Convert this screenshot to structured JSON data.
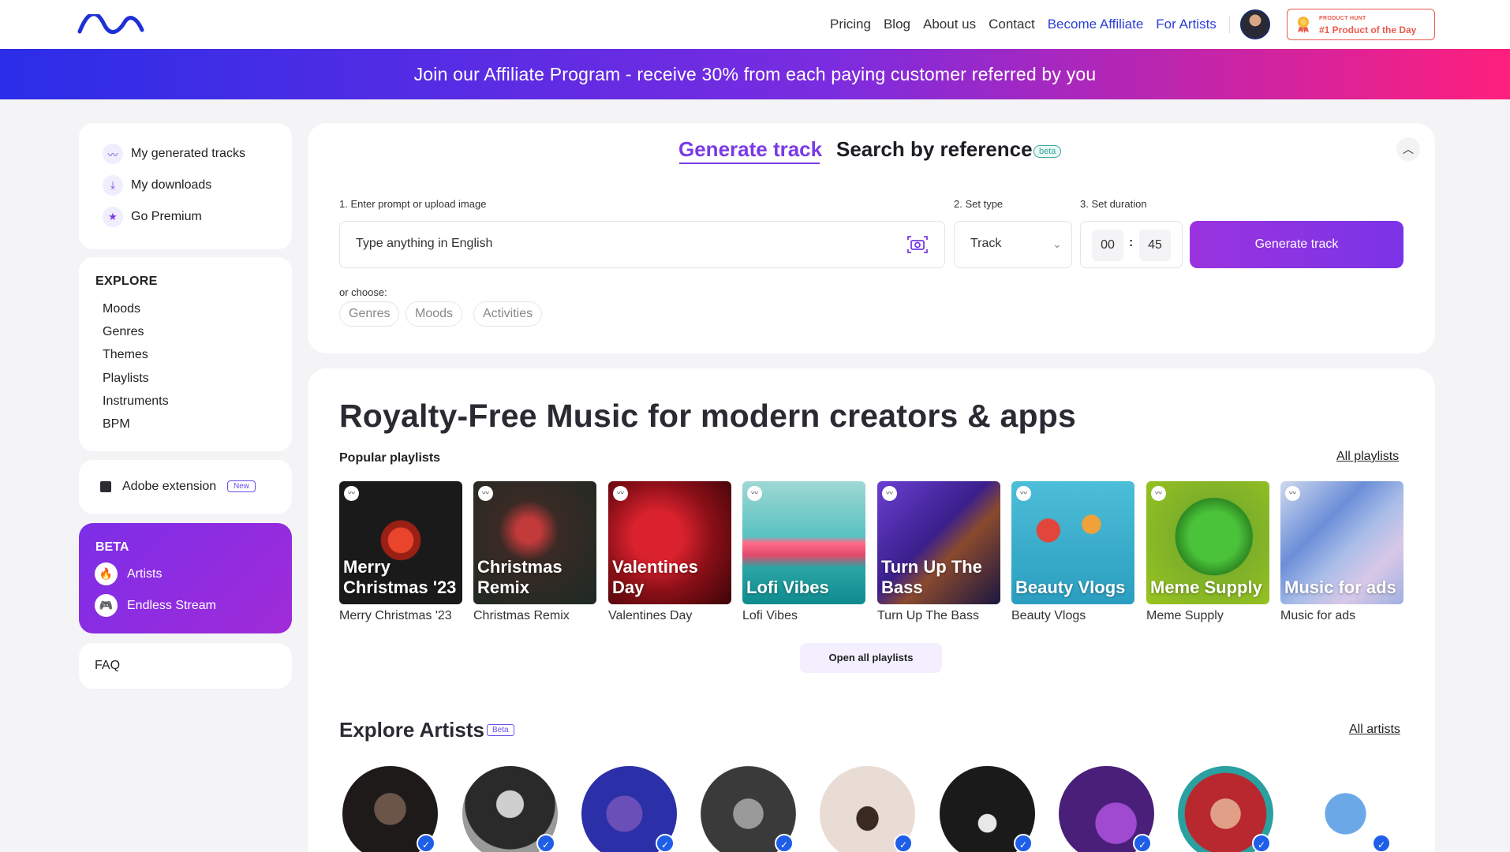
{
  "header": {
    "nav": [
      "Pricing",
      "Blog",
      "About us",
      "Contact"
    ],
    "nav_accent": [
      "Become Affiliate",
      "For Artists"
    ],
    "producthunt": {
      "line1": "PRODUCT HUNT",
      "line2": "#1 Product of the Day"
    }
  },
  "banner": {
    "text": "Join our Affiliate Program - receive 30% from each paying customer referred by you"
  },
  "sidebar": {
    "top_items": [
      {
        "label": "My generated tracks",
        "icon": "wave-icon"
      },
      {
        "label": "My downloads",
        "icon": "download-icon"
      },
      {
        "label": "Go Premium",
        "icon": "star-icon"
      }
    ],
    "explore_title": "EXPLORE",
    "explore_items": [
      "Moods",
      "Genres",
      "Themes",
      "Playlists",
      "Instruments",
      "BPM"
    ],
    "adobe": {
      "label": "Adobe extension",
      "badge": "New"
    },
    "beta": {
      "title": "BETA",
      "items": [
        {
          "label": "Artists",
          "icon": "fire-icon"
        },
        {
          "label": "Endless Stream",
          "icon": "gamepad-icon"
        }
      ]
    },
    "faq": "FAQ"
  },
  "generator": {
    "tab_generate": "Generate track",
    "tab_reference": "Search by reference",
    "beta": "beta",
    "step1": "1. Enter prompt or upload image",
    "step2": "2. Set type",
    "step3": "3. Set duration",
    "prompt_placeholder": "Type anything in English",
    "type_value": "Track",
    "minutes": "00",
    "seconds": "45",
    "button": "Generate track",
    "or_choose": "or choose:",
    "chips": [
      "Genres",
      "Moods",
      "Activities"
    ]
  },
  "main": {
    "title": "Royalty-Free Music for modern creators & apps",
    "popular_label": "Popular playlists",
    "all_playlists": "All playlists",
    "playlists": [
      {
        "overlay": "Merry Christmas '23",
        "caption": "Merry Christmas '23"
      },
      {
        "overlay": "Christmas Remix",
        "caption": "Christmas Remix"
      },
      {
        "overlay": "Valentines Day",
        "caption": "Valentines Day"
      },
      {
        "overlay": "Lofi Vibes",
        "caption": "Lofi Vibes"
      },
      {
        "overlay": "Turn Up The Bass",
        "caption": "Turn Up The Bass"
      },
      {
        "overlay": "Beauty Vlogs",
        "caption": "Beauty Vlogs"
      },
      {
        "overlay": "Meme Supply",
        "caption": "Meme Supply"
      },
      {
        "overlay": "Music for ads",
        "caption": "Music for ads"
      }
    ],
    "open_all": "Open all playlists",
    "artists_title": "Explore Artists",
    "artists_beta": "Beta",
    "all_artists": "All artists"
  },
  "colors": {
    "accent": "#7a3be6",
    "link": "#2b3fd6",
    "banner_start": "#2b2de8",
    "banner_end": "#ff1f7d"
  }
}
